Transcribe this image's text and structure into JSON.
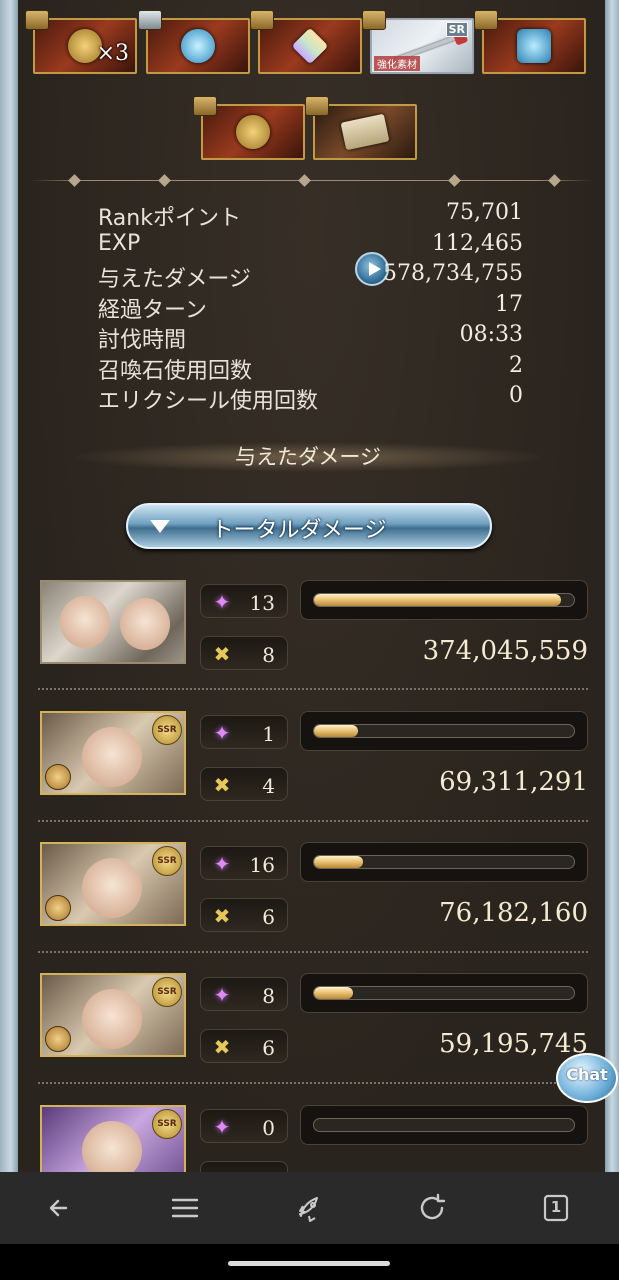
{
  "rewards": {
    "row1": [
      {
        "kind": "medal",
        "qty": "×3"
      },
      {
        "kind": "blue-orb",
        "qty": ""
      },
      {
        "kind": "crystal",
        "qty": ""
      },
      {
        "kind": "sword",
        "badge": "SR",
        "caption": "強化素材"
      },
      {
        "kind": "flag",
        "qty": ""
      }
    ],
    "row2": [
      {
        "kind": "medal",
        "qty": ""
      },
      {
        "kind": "scroll",
        "qty": ""
      }
    ]
  },
  "stats": [
    {
      "label": "Rankポイント",
      "value": "75,701"
    },
    {
      "label": "EXP",
      "value": "112,465"
    },
    {
      "label": "与えたダメージ",
      "value": "578,734,755"
    },
    {
      "label": "経過ターン",
      "value": "17"
    },
    {
      "label": "討伐時間",
      "value": "08:33"
    },
    {
      "label": "召喚石使用回数",
      "value": "2"
    },
    {
      "label": "エリクシール使用回数",
      "value": "0"
    }
  ],
  "section_title": "与えたダメージ",
  "total_button": "トータルダメージ",
  "characters": [
    {
      "name": "main-character",
      "ability": "13",
      "chain": "8",
      "damage": "374,045,559",
      "share": 0.95,
      "ssr": false
    },
    {
      "name": "character-2",
      "ability": "1",
      "chain": "4",
      "damage": "69,311,291",
      "share": 0.17,
      "ssr": true
    },
    {
      "name": "character-3",
      "ability": "16",
      "chain": "6",
      "damage": "76,182,160",
      "share": 0.19,
      "ssr": true
    },
    {
      "name": "character-4",
      "ability": "8",
      "chain": "6",
      "damage": "59,195,745",
      "share": 0.15,
      "ssr": true
    },
    {
      "name": "character-5",
      "ability": "0",
      "chain": "",
      "damage": "",
      "share": 0.0,
      "ssr": true
    }
  ],
  "ssr_badge": "SSR",
  "chat_label": "Chat",
  "nav": {
    "tab_count": "1"
  }
}
